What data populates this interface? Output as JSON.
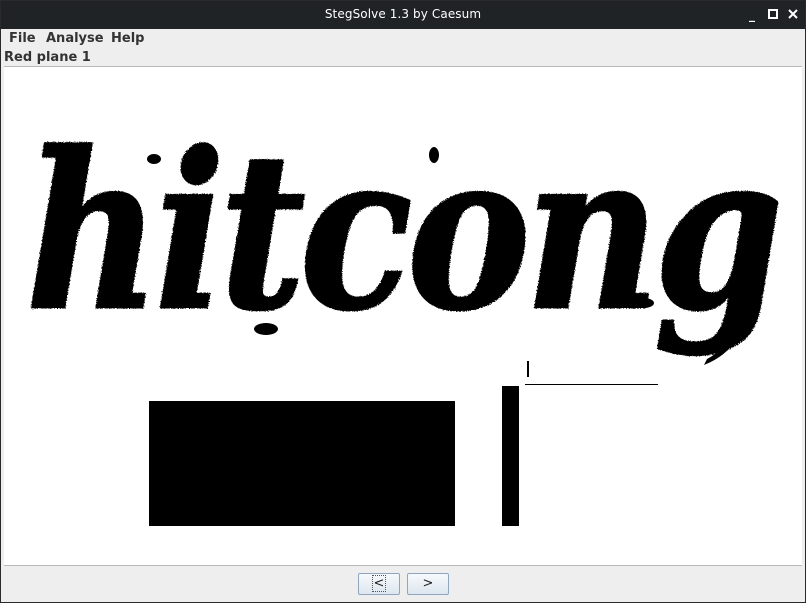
{
  "window": {
    "title": "StegSolve 1.3 by Caesum",
    "minimize_glyph": "_",
    "maximize_glyph": "□",
    "close_glyph": "✕"
  },
  "menu": {
    "items": [
      {
        "label": "File"
      },
      {
        "label": "Analyse"
      },
      {
        "label": "Help"
      }
    ]
  },
  "viewer": {
    "plane_label": "Red plane 1",
    "image_text": "hitcong",
    "image_style": "blackletter bit-plane render, black on white"
  },
  "navigation": {
    "prev_label": "<",
    "next_label": ">"
  },
  "colors": {
    "titlebar": "#1f2326",
    "panel_bg": "#eeeeee",
    "image_bg": "#ffffff",
    "ink": "#000000"
  }
}
